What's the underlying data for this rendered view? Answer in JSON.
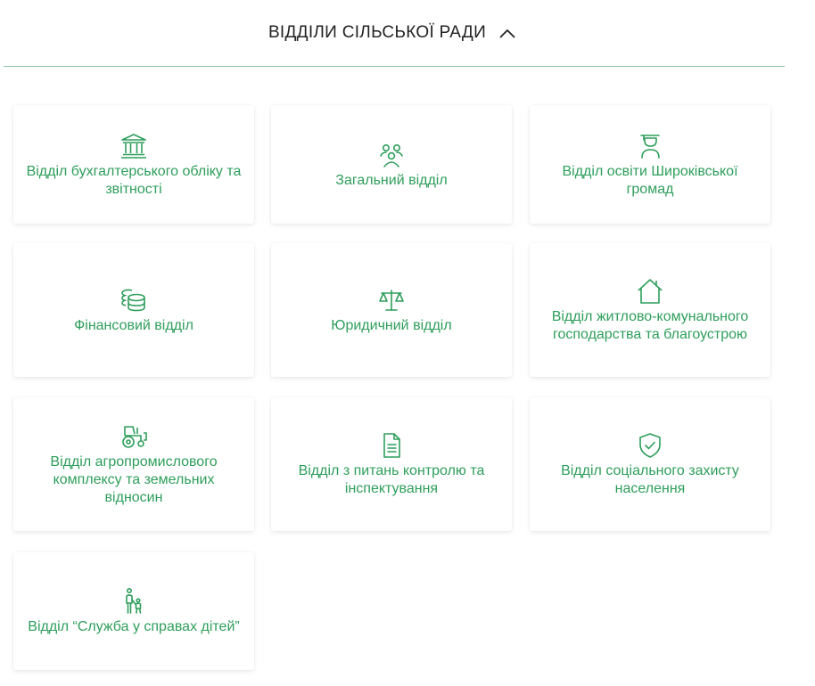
{
  "header": {
    "title": "ВІДДІЛИ СІЛЬСЬКОЇ РАДИ",
    "toggle_icon": "chevron-up-icon"
  },
  "colors": {
    "accent": "#2e9e5b",
    "divider": "#8fc4a6",
    "title_text": "#222222"
  },
  "departments": [
    {
      "label": "Відділ бухгалтерського обліку та звітності",
      "icon": "bank-icon"
    },
    {
      "label": "Загальний відділ",
      "icon": "people-group-icon"
    },
    {
      "label": "Відділ освіти Широківської громад",
      "icon": "graduate-icon"
    },
    {
      "label": "Фінансовий відділ",
      "icon": "coins-stack-icon"
    },
    {
      "label": "Юридичний відділ",
      "icon": "scales-icon"
    },
    {
      "label": "Відділ житлово-комунального господарства та благоустрою",
      "icon": "house-icon"
    },
    {
      "label": "Відділ агропромислового комплексу та земельних відносин",
      "icon": "tractor-icon"
    },
    {
      "label": "Відділ з питань контролю та інспектування",
      "icon": "document-icon"
    },
    {
      "label": "Відділ соціального захисту населення",
      "icon": "shield-check-icon"
    },
    {
      "label": "Відділ “Служба у справах дітей”",
      "icon": "parent-child-icon"
    }
  ]
}
